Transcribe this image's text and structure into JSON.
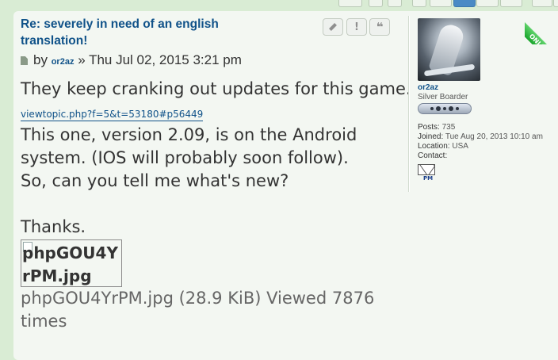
{
  "post": {
    "title": "Re: severely in need of an english translation!",
    "by_prefix": "by",
    "author": "or2az",
    "separator": "»",
    "date": "Thu Jul 02, 2015 3:21 pm",
    "buttons": {
      "edit_icon": "pencil-icon",
      "report_icon": "exclamation-icon",
      "quote_icon": "quote-icon",
      "report_symbol": "!",
      "quote_symbol": "❝"
    },
    "lines": {
      "l1": "They keep cranking out updates for this game.",
      "l2": "This one, version 2.09, is on the Android",
      "l3": "system. (IOS will probably soon follow).",
      "l4": "So, can you tell me what's new?",
      "l5": "Thanks."
    },
    "link_text": "viewtopic.php?f=5&t=53180#p56449",
    "image": {
      "alt": "phpGOU4YrPM.jpg",
      "caption": "phpGOU4YrPM.jpg (28.9 KiB) Viewed 7876 times"
    }
  },
  "profile": {
    "username": "or2az",
    "rank": "Silver Boarder",
    "posts_label": "Posts:",
    "posts": "735",
    "joined_label": "Joined:",
    "joined": "Tue Aug 20, 2013 10:10 am",
    "location_label": "Location:",
    "location": "USA",
    "contact_label": "Contact:",
    "pm_label": "PM",
    "online_label": "ONLINE"
  },
  "colors": {
    "link": "#105289",
    "background": "#d9ecd4",
    "post_bg": "#f3f7f2",
    "online": "#18a52b"
  }
}
